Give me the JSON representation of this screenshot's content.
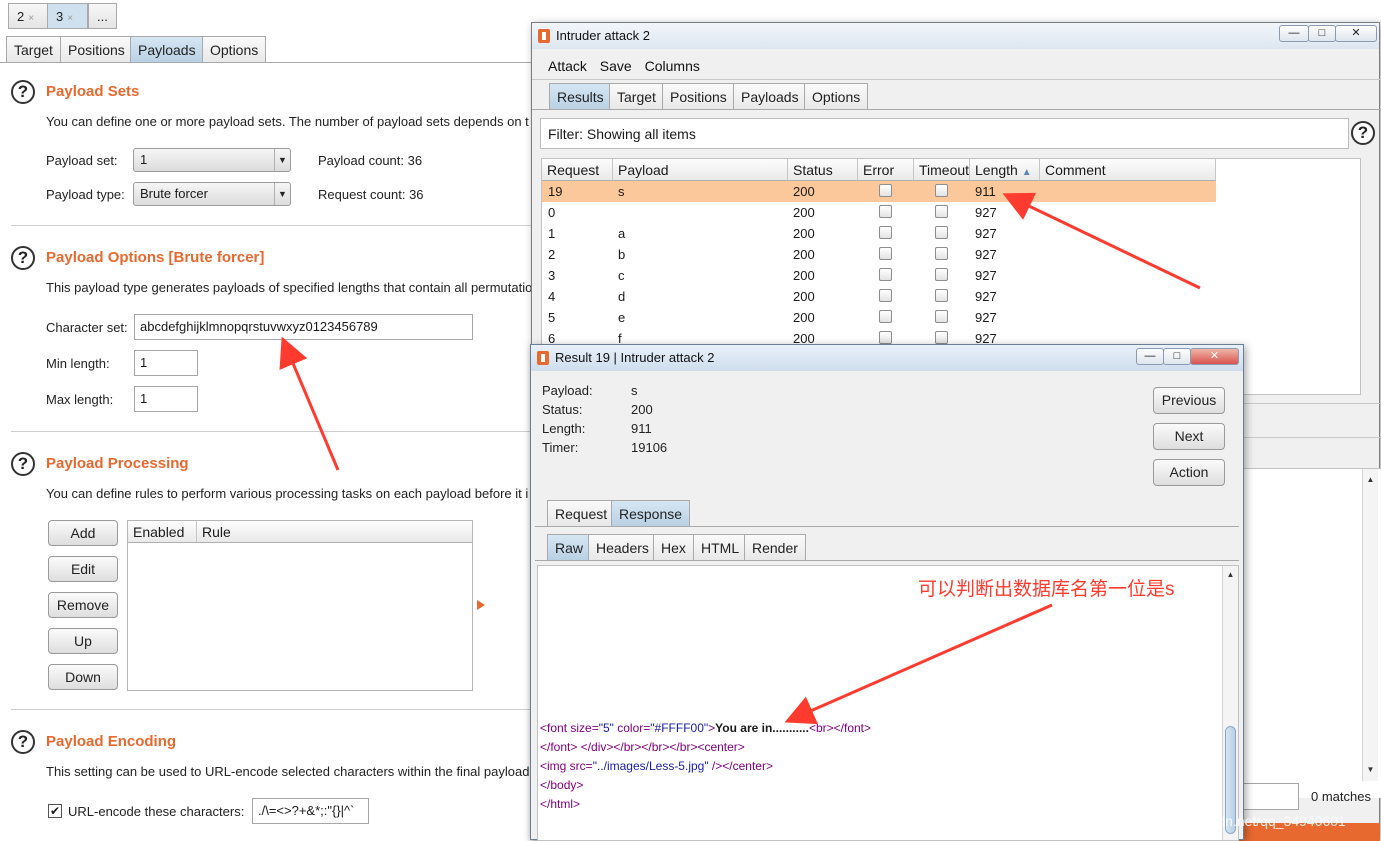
{
  "top_tabs": [
    {
      "label": "2",
      "close": "×"
    },
    {
      "label": "3",
      "close": "×"
    },
    {
      "label": "..."
    }
  ],
  "main_tabs": [
    "Target",
    "Positions",
    "Payloads",
    "Options"
  ],
  "payload_sets": {
    "title": "Payload Sets",
    "desc": "You can define one or more payload sets. The number of payload sets depends on t",
    "set_label": "Payload set:",
    "set_value": "1",
    "count_label": "Payload count:",
    "count_value": "36",
    "type_label": "Payload type:",
    "type_value": "Brute forcer",
    "request_label": "Request count:",
    "request_value": "36"
  },
  "payload_options": {
    "title": "Payload Options [Brute forcer]",
    "desc": "This payload type generates payloads of specified lengths that contain all permutatio",
    "charset_label": "Character set:",
    "charset_value": "abcdefghijklmnopqrstuvwxyz0123456789",
    "min_label": "Min length:",
    "min_value": "1",
    "max_label": "Max length:",
    "max_value": "1"
  },
  "payload_processing": {
    "title": "Payload Processing",
    "desc": "You can define rules to perform various processing tasks on each payload before it i",
    "buttons": [
      "Add",
      "Edit",
      "Remove",
      "Up",
      "Down"
    ],
    "table_headers": [
      "Enabled",
      "Rule"
    ]
  },
  "payload_encoding": {
    "title": "Payload Encoding",
    "desc": "This setting can be used to URL-encode selected characters within the final payload",
    "checkbox_label": "URL-encode these characters:",
    "chars": "./\\=<>?+&*;:\"{}|^`"
  },
  "attack_window": {
    "title": "Intruder attack 2",
    "menu": [
      "Attack",
      "Save",
      "Columns"
    ],
    "tabs": [
      "Results",
      "Target",
      "Positions",
      "Payloads",
      "Options"
    ],
    "filter": "Filter: Showing all items",
    "help_icon": "?",
    "columns": [
      "Request",
      "Payload",
      "Status",
      "Error",
      "Timeout",
      "Length",
      "Comment"
    ],
    "sort_indicator": "▲",
    "rows": [
      {
        "request": "19",
        "payload": "s",
        "status": "200",
        "length": "911"
      },
      {
        "request": "0",
        "payload": "",
        "status": "200",
        "length": "927"
      },
      {
        "request": "1",
        "payload": "a",
        "status": "200",
        "length": "927"
      },
      {
        "request": "2",
        "payload": "b",
        "status": "200",
        "length": "927"
      },
      {
        "request": "3",
        "payload": "c",
        "status": "200",
        "length": "927"
      },
      {
        "request": "4",
        "payload": "d",
        "status": "200",
        "length": "927"
      },
      {
        "request": "5",
        "payload": "e",
        "status": "200",
        "length": "927"
      },
      {
        "request": "6",
        "payload": "f",
        "status": "200",
        "length": "927"
      },
      {
        "request": "",
        "payload": "",
        "status": "200",
        "length": "927"
      }
    ],
    "matches": "0 matches"
  },
  "result_window": {
    "title": "Result 19 | Intruder attack 2",
    "fields": [
      {
        "label": "Payload:",
        "value": "s"
      },
      {
        "label": "Status:",
        "value": "200"
      },
      {
        "label": "Length:",
        "value": "911"
      },
      {
        "label": "Timer:",
        "value": "19106"
      }
    ],
    "buttons": [
      "Previous",
      "Next",
      "Action"
    ],
    "tabs": [
      "Request",
      "Response"
    ],
    "subtabs": [
      "Raw",
      "Headers",
      "Hex",
      "HTML",
      "Render"
    ],
    "code": {
      "l1_open": "<font size=",
      "l1_v1": "\"5\"",
      "l1_attr": " color=",
      "l1_v2": "\"#FFFF00\"",
      "l1_gt": ">",
      "l1_bold": "You are in...........",
      "l1_end": "<br></font>",
      "l2": "</font> </div></br></br></br><center>",
      "l3_open": "<img src=",
      "l3_val": "\"../images/Less-5.jpg\"",
      "l3_end": " /></center>",
      "l4": "</body>",
      "l5": "</html>"
    }
  },
  "annotation": "可以判断出数据库名第一位是s",
  "watermark": "https://blog.csdn.net/qq_34940601",
  "colors": {
    "accent": "#e8692f",
    "selected_row": "#fbc89b",
    "arrow": "#ff3b2f"
  }
}
